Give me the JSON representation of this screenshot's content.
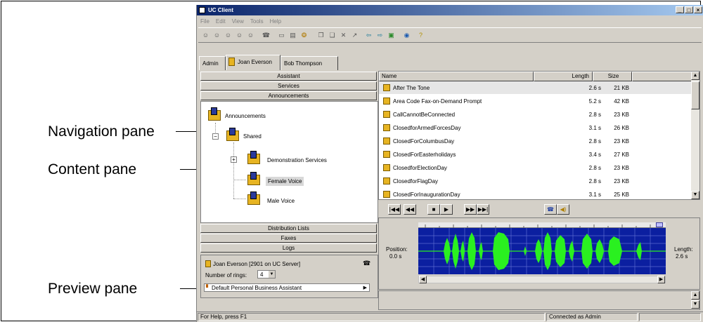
{
  "callouts": {
    "navigation": "Navigation pane",
    "content": "Content pane",
    "preview": "Preview pane"
  },
  "window": {
    "title": "UC Client",
    "buttons": [
      "_",
      "□",
      "×"
    ]
  },
  "menu": [
    "File",
    "Edit",
    "View",
    "Tools",
    "Help"
  ],
  "toolbar_icons": [
    "user-icon",
    "user-icon",
    "user-icon",
    "user-icon",
    "user-icon",
    "phone-icon",
    "folder-icon",
    "folder-icon",
    "users-icon",
    "copy-icon",
    "paste-icon",
    "delete-icon",
    "arrow-icon",
    "back-icon",
    "forward-icon",
    "refresh-icon",
    "globe-icon",
    "help-icon"
  ],
  "tabs": [
    "Admin",
    "Joan Everson",
    "Bob Thompson"
  ],
  "nav": {
    "sections_top": [
      "Assistant",
      "Services",
      "Announcements"
    ],
    "tree": {
      "root": "Announcements",
      "shared": "Shared",
      "items": [
        "Demonstration Services",
        "Female Voice",
        "Male Voice"
      ]
    },
    "sections_bottom": [
      "Distribution Lists",
      "Faxes",
      "Logs"
    ]
  },
  "status_box": {
    "user": "Joan Everson [2901 on UC Server]",
    "rings_label": "Number of rings:",
    "rings_value": "4",
    "assistant": "Default Personal Business Assistant"
  },
  "list": {
    "columns": [
      "Name",
      "Length",
      "Size"
    ],
    "rows": [
      {
        "name": "After The Tone",
        "length": "2.6 s",
        "size": "21 KB"
      },
      {
        "name": "Area Code Fax-on-Demand Prompt",
        "length": "5.2 s",
        "size": "42 KB"
      },
      {
        "name": "CallCannotBeConnected",
        "length": "2.8 s",
        "size": "23 KB"
      },
      {
        "name": "ClosedforArmedForcesDay",
        "length": "3.1 s",
        "size": "26 KB"
      },
      {
        "name": "ClosedForColumbusDay",
        "length": "2.8 s",
        "size": "23 KB"
      },
      {
        "name": "ClosedForEasterholidays",
        "length": "3.4 s",
        "size": "27 KB"
      },
      {
        "name": "ClosedforElectionDay",
        "length": "2.8 s",
        "size": "23 KB"
      },
      {
        "name": "ClosedforFlagDay",
        "length": "2.8 s",
        "size": "23 KB"
      },
      {
        "name": "ClosedForInaugurationDay",
        "length": "3.1 s",
        "size": "25 KB"
      }
    ]
  },
  "player": {
    "position_label": "Position:",
    "position_value": "0.0 s",
    "length_label": "Length:",
    "length_value": "2.6 s",
    "buttons": [
      "|◀◀",
      "◀◀",
      "■",
      "▶",
      "▶▶",
      "▶▶|"
    ],
    "colors": {
      "background": "#0b1fa0",
      "grid": "#5b6ad0",
      "wave": "#2af020"
    }
  },
  "statusbar": {
    "help": "For Help, press F1",
    "connection": "Connected as Admin"
  }
}
